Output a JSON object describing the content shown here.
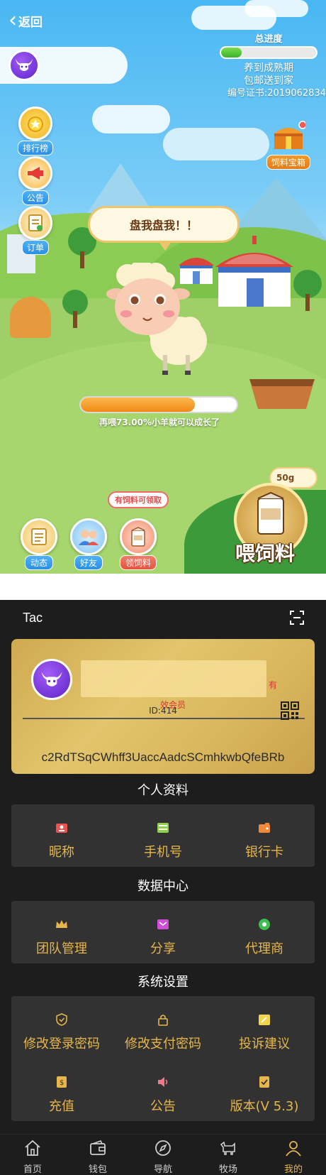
{
  "game": {
    "back_label": "返回",
    "progress": {
      "title": "总进度",
      "value": 0.22,
      "line1": "养到成熟期",
      "line2": "包邮送到家"
    },
    "certificate": "编号证书:2019062834",
    "side_buttons": [
      {
        "label": "排行榜",
        "icon": "medal-icon"
      },
      {
        "label": "公告",
        "icon": "megaphone-icon"
      },
      {
        "label": "订单",
        "icon": "order-icon"
      }
    ],
    "treasure_label": "饲料宝箱",
    "speech": "盘我盘我！！",
    "growth": {
      "value": 0.73,
      "text": "再喂73.00%小羊就可以成长了"
    },
    "feed_amount": "50g",
    "feed_button": "喂饲料",
    "tip": "有饲料可领取",
    "bottom_buttons": [
      {
        "label": "动态",
        "icon": "news-icon"
      },
      {
        "label": "好友",
        "icon": "friends-icon"
      },
      {
        "label": "领饲料",
        "icon": "feed-bag-icon"
      }
    ]
  },
  "profile": {
    "title": "Tac",
    "card": {
      "vip_suffix": "有",
      "vip_label": "效会员",
      "id": "ID:414",
      "code": "c2RdTSqCWhff3UaccAadcSCmhkwbQfeBRb"
    },
    "sections": [
      {
        "title": "个人资料",
        "items": [
          "昵称",
          "手机号",
          "银行卡"
        ]
      },
      {
        "title": "数据中心",
        "items": [
          "团队管理",
          "分享",
          "代理商"
        ]
      },
      {
        "title": "系统设置",
        "items": [
          "修改登录密码",
          "修改支付密码",
          "投诉建议",
          "充值",
          "公告",
          "版本(V 5.3)"
        ]
      }
    ],
    "tabs": [
      {
        "label": "首页",
        "icon": "home-icon"
      },
      {
        "label": "钱包",
        "icon": "wallet-icon"
      },
      {
        "label": "导航",
        "icon": "compass-icon"
      },
      {
        "label": "牧场",
        "icon": "ranch-icon"
      },
      {
        "label": "我的",
        "icon": "user-icon"
      }
    ],
    "active_tab": 4
  },
  "colors": {
    "accent_gold": "#e7b64a",
    "panel": "#323233",
    "background_dark": "#1d1d1e",
    "sky": "#49b7f3"
  }
}
